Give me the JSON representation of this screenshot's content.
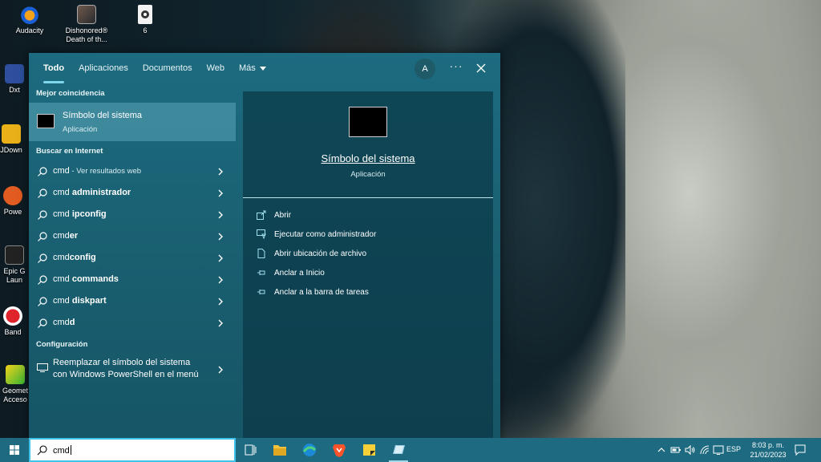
{
  "desktop": {
    "icons": [
      {
        "label": "Audacity",
        "icon": "audacity-icon"
      },
      {
        "label": "Dishonored® Death of th...",
        "icon": "dishonored-icon"
      },
      {
        "label": "6",
        "icon": "media-file-icon"
      },
      {
        "label": "Dxt",
        "icon": "shortcut-icon"
      },
      {
        "label": "JDown",
        "icon": "jdownloader-icon"
      },
      {
        "label": "Powe",
        "icon": "shortcut-icon"
      },
      {
        "label": "Epic G Laun",
        "icon": "epic-games-icon"
      },
      {
        "label": "Band",
        "icon": "bandicam-icon"
      },
      {
        "label": "Geomet Acceso",
        "icon": "geometry-dash-icon"
      }
    ]
  },
  "search": {
    "tabs": [
      {
        "label": "Todo",
        "active": true
      },
      {
        "label": "Aplicaciones"
      },
      {
        "label": "Documentos"
      },
      {
        "label": "Web"
      },
      {
        "label": "Más"
      }
    ],
    "account_initial": "A",
    "more_label": "···",
    "best_match": {
      "heading": "Mejor coincidencia",
      "title": "Símbolo del sistema",
      "subtitle": "Aplicación"
    },
    "web": {
      "heading": "Buscar en Internet",
      "results": [
        {
          "prefix": "cmd",
          "bold": "",
          "hint": " - Ver resultados web"
        },
        {
          "prefix": "cmd ",
          "bold": "administrador",
          "hint": ""
        },
        {
          "prefix": "cmd ",
          "bold": "ipconfig",
          "hint": ""
        },
        {
          "prefix": "cmd",
          "bold": "er",
          "hint": ""
        },
        {
          "prefix": "cmd",
          "bold": "config",
          "hint": ""
        },
        {
          "prefix": "cmd ",
          "bold": "commands",
          "hint": ""
        },
        {
          "prefix": "cmd ",
          "bold": "diskpart",
          "hint": ""
        },
        {
          "prefix": "cmd",
          "bold": "d",
          "hint": ""
        }
      ]
    },
    "settings": {
      "heading": "Configuración",
      "line1": "Reemplazar el símbolo del sistema",
      "line2": "con Windows PowerShell en el menú"
    },
    "preview": {
      "title": "Símbolo del sistema",
      "subtitle": "Aplicación",
      "actions": [
        {
          "label": "Abrir",
          "icon": "open-icon"
        },
        {
          "label": "Ejecutar como administrador",
          "icon": "run-as-admin-icon"
        },
        {
          "label": "Abrir ubicación de archivo",
          "icon": "file-location-icon"
        },
        {
          "label": "Anclar a Inicio",
          "icon": "pin-icon"
        },
        {
          "label": "Anclar a la barra de tareas",
          "icon": "pin-icon"
        }
      ]
    }
  },
  "taskbar": {
    "query": "cmd",
    "language": "ESP",
    "time": "8:03 p. m.",
    "date": "21/02/2023",
    "colors": {
      "taskbar": "#1e6b81",
      "accent": "#7fd6ec"
    }
  }
}
